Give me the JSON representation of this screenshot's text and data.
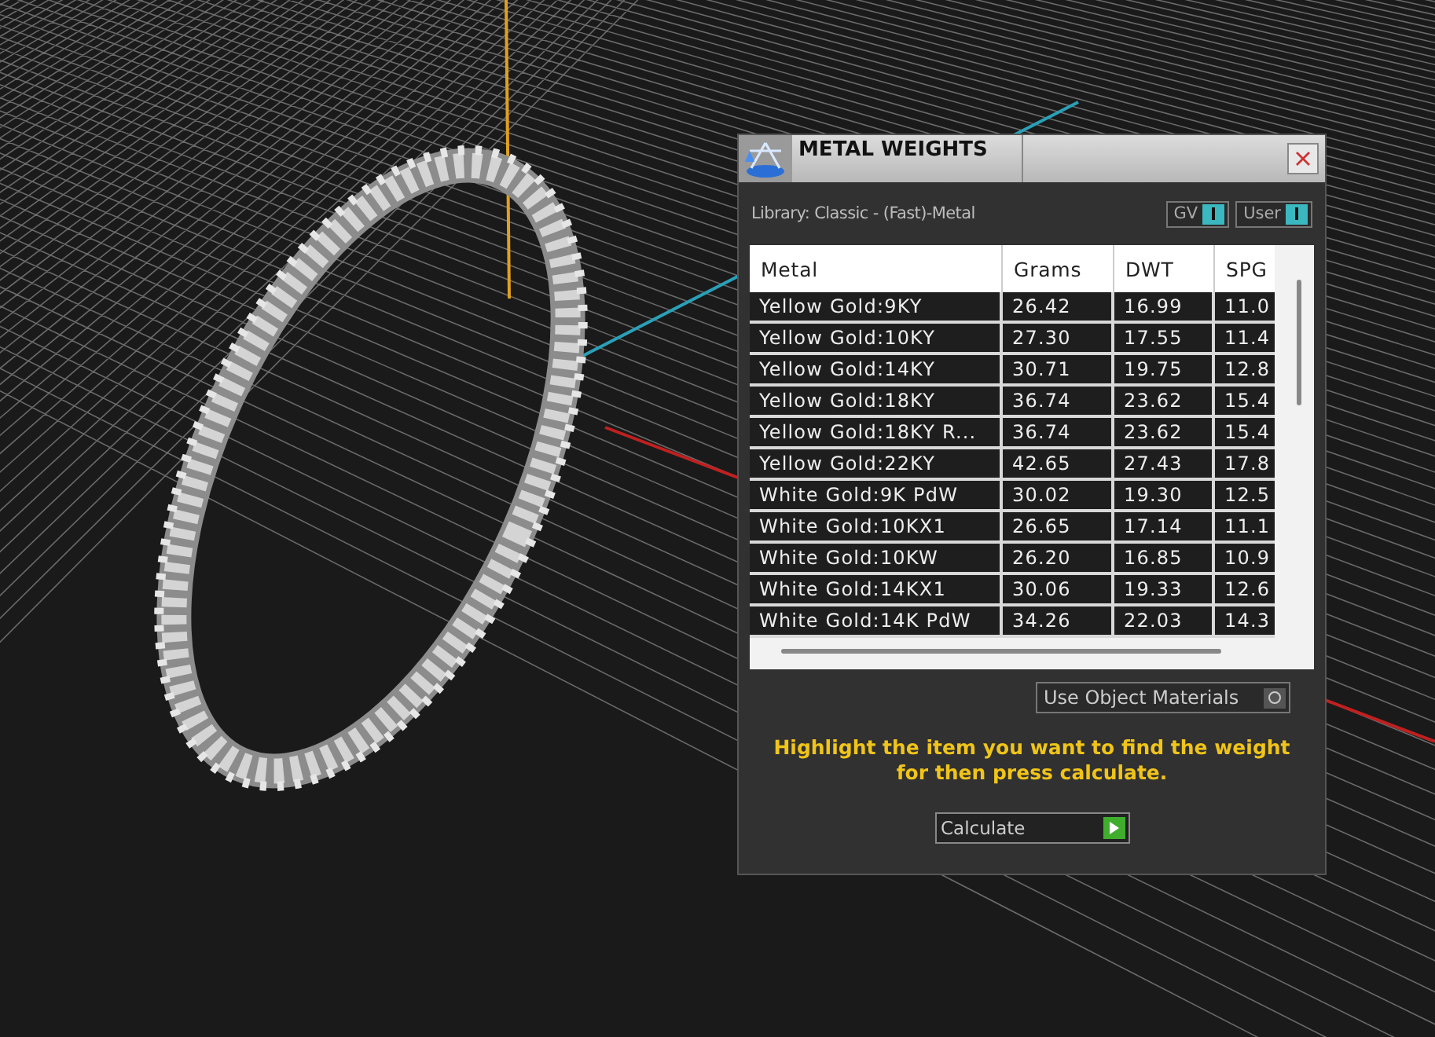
{
  "dialog": {
    "title": "METAL WEIGHTS",
    "library_label": "Library: Classic - (Fast)-Metal",
    "toggles": [
      {
        "label": "GV",
        "on": true
      },
      {
        "label": "User",
        "on": true
      }
    ],
    "table": {
      "columns": [
        "Metal",
        "Grams",
        "DWT",
        "SPG"
      ],
      "rows": [
        [
          "Yellow Gold:9KY",
          "26.42",
          "16.99",
          "11.0"
        ],
        [
          "Yellow Gold:10KY",
          "27.30",
          "17.55",
          "11.4"
        ],
        [
          "Yellow Gold:14KY",
          "30.71",
          "19.75",
          "12.8"
        ],
        [
          "Yellow Gold:18KY",
          "36.74",
          "23.62",
          "15.4"
        ],
        [
          "Yellow Gold:18KY R...",
          "36.74",
          "23.62",
          "15.4"
        ],
        [
          "Yellow Gold:22KY",
          "42.65",
          "27.43",
          "17.8"
        ],
        [
          "White Gold:9K PdW",
          "30.02",
          "19.30",
          "12.5"
        ],
        [
          "White Gold:10KX1",
          "26.65",
          "17.14",
          "11.1"
        ],
        [
          "White Gold:10KW",
          "26.20",
          "16.85",
          "10.9"
        ],
        [
          "White Gold:14KX1",
          "30.06",
          "19.33",
          "12.6"
        ],
        [
          "White Gold:14K PdW",
          "34.26",
          "22.03",
          "14.3"
        ]
      ]
    },
    "materials_toggle": {
      "label": "Use Object Materials",
      "on": false
    },
    "hint": "Highlight the item you want to find the weight for then press calculate.",
    "calculate_button": "Calculate"
  }
}
